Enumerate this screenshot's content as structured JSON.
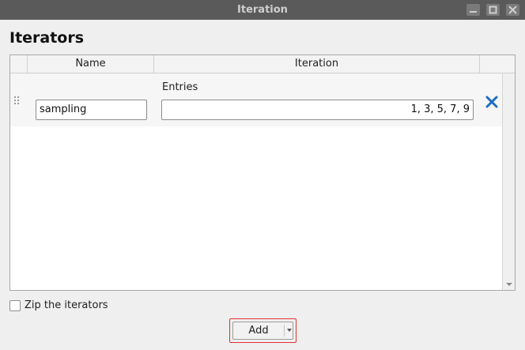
{
  "window": {
    "title": "Iteration",
    "controls": [
      "minimize-icon",
      "maximize-icon",
      "close-icon"
    ]
  },
  "heading": "Iterators",
  "table": {
    "columns": [
      "Name",
      "Iteration"
    ],
    "rows": [
      {
        "name": "sampling",
        "iteration_type_label": "Entries",
        "entries": "1, 3, 5, 7, 9"
      }
    ]
  },
  "zip": {
    "label": "Zip the iterators",
    "checked": false
  },
  "add_button": {
    "label": "Add"
  },
  "colors": {
    "titlebar": "#5a5a5a",
    "remove_icon": "#1e6fc0",
    "focus_outline": "#e0312f"
  }
}
